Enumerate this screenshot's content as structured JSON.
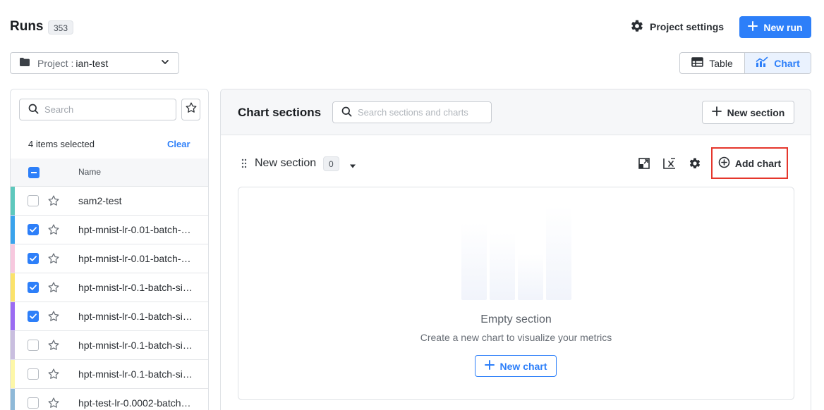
{
  "header": {
    "title": "Runs",
    "run_count": "353",
    "project_settings_label": "Project settings",
    "new_run_label": "New run"
  },
  "project_selector": {
    "key": "Project :",
    "value": "ian-test"
  },
  "view_toggle": {
    "table_label": "Table",
    "chart_label": "Chart",
    "selected": "Chart"
  },
  "runs_panel": {
    "search_placeholder": "Search",
    "selection_text": "4 items selected",
    "clear_label": "Clear",
    "name_header": "Name",
    "runs": [
      {
        "name": "sam2-test",
        "checked": false,
        "color": "#5ec8bd"
      },
      {
        "name": "hpt-mnist-lr-0.01-batch-…",
        "checked": true,
        "color": "#3aa3ec"
      },
      {
        "name": "hpt-mnist-lr-0.01-batch-…",
        "checked": true,
        "color": "#f7c8de"
      },
      {
        "name": "hpt-mnist-lr-0.1-batch-si…",
        "checked": true,
        "color": "#fbe26b"
      },
      {
        "name": "hpt-mnist-lr-0.1-batch-si…",
        "checked": true,
        "color": "#9b6cf2"
      },
      {
        "name": "hpt-mnist-lr-0.1-batch-si…",
        "checked": false,
        "color": "#c9bedf"
      },
      {
        "name": "hpt-mnist-lr-0.1-batch-si…",
        "checked": false,
        "color": "#fdf7a8"
      },
      {
        "name": "hpt-test-lr-0.0002-batch…",
        "checked": false,
        "color": "#8fb9d8"
      }
    ]
  },
  "charts_panel": {
    "title": "Chart sections",
    "search_placeholder": "Search sections and charts",
    "new_section_label": "New section",
    "section": {
      "name": "New section",
      "chart_count": "0",
      "add_chart_label": "Add chart",
      "empty_title": "Empty section",
      "empty_subtitle": "Create a new chart to visualize your metrics",
      "new_chart_label": "New chart"
    }
  },
  "icons": {
    "folder": "folder-icon",
    "chevron": "chevron-down-icon",
    "gear": "gear-icon",
    "plus": "plus-icon",
    "table": "table-icon",
    "chart": "chart-icon",
    "search": "search-icon",
    "star": "star-icon"
  },
  "colors": {
    "accent": "#2d7ff9",
    "highlight_border": "#e5362c"
  }
}
